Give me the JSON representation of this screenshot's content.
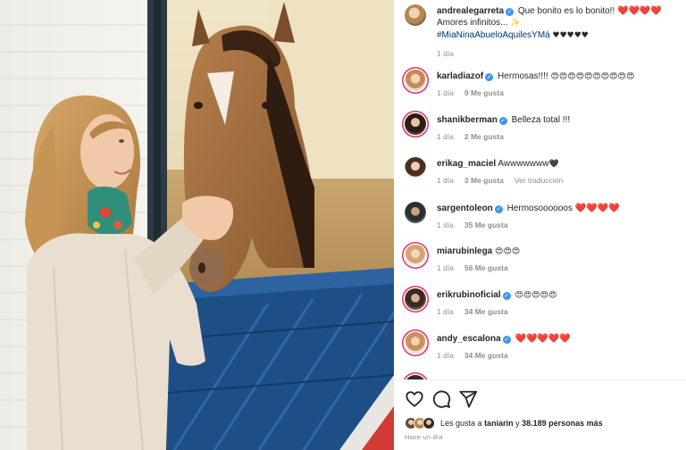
{
  "post": {
    "caption": {
      "username": "andrealegarreta",
      "text": "Que bonito es lo bonito!!",
      "emoji_after_text": "❤️❤️❤️❤️",
      "line2": "Amores infinitos...",
      "line2_emoji": "✨",
      "hashtag": "#MiaNinaAbueloAquilesYMá",
      "hearts": "♥♥♥♥♥",
      "time": "1 día"
    },
    "comments": [
      {
        "username": "karladiazof",
        "verified": true,
        "text": "Hermosas!!!!",
        "emoji": "😍😍😍😍😍😍😍😍😍😍",
        "time": "1 día",
        "likes": "9 Me gusta",
        "translate": ""
      },
      {
        "username": "shanikberman",
        "verified": true,
        "text": "Belleza total !!!",
        "emoji": "",
        "time": "1 día",
        "likes": "2 Me gusta",
        "translate": ""
      },
      {
        "username": "erikag_maciel",
        "verified": false,
        "text": "Awwwwwww",
        "emoji": "🖤",
        "time": "1 día",
        "likes": "3 Me gusta",
        "translate": "Ver traducción"
      },
      {
        "username": "sargentoleon",
        "verified": true,
        "text": "Hermosoooooos",
        "emoji": "❤️❤️❤️❤️",
        "time": "1 día",
        "likes": "35 Me gusta",
        "translate": ""
      },
      {
        "username": "miarubinlega",
        "verified": false,
        "text": "",
        "emoji": "😍😍😍",
        "time": "1 día",
        "likes": "56 Me gusta",
        "translate": ""
      },
      {
        "username": "erikrubinoficial",
        "verified": true,
        "text": "",
        "emoji": "😍😍😍😍😍",
        "time": "1 día",
        "likes": "34 Me gusta",
        "translate": ""
      },
      {
        "username": "andy_escalona",
        "verified": true,
        "text": "",
        "emoji": "❤️❤️❤️❤️❤️",
        "time": "1 día",
        "likes": "34 Me gusta",
        "translate": ""
      }
    ],
    "actions": {
      "like_icon": "heart-outline-icon",
      "comment_icon": "comment-bubble-icon",
      "share_icon": "paper-plane-icon"
    },
    "likes_summary": {
      "prefix": "Les gusta a",
      "user": "taniarin",
      "middle": "y",
      "count": "38.189 personas más"
    },
    "posted_ago": "Hace un día"
  },
  "colors": {
    "link": "#00376b",
    "muted": "#8e8e8e",
    "verified": "#3897f0",
    "heart": "#e0245e",
    "stall_blue": "#1d4f86"
  }
}
